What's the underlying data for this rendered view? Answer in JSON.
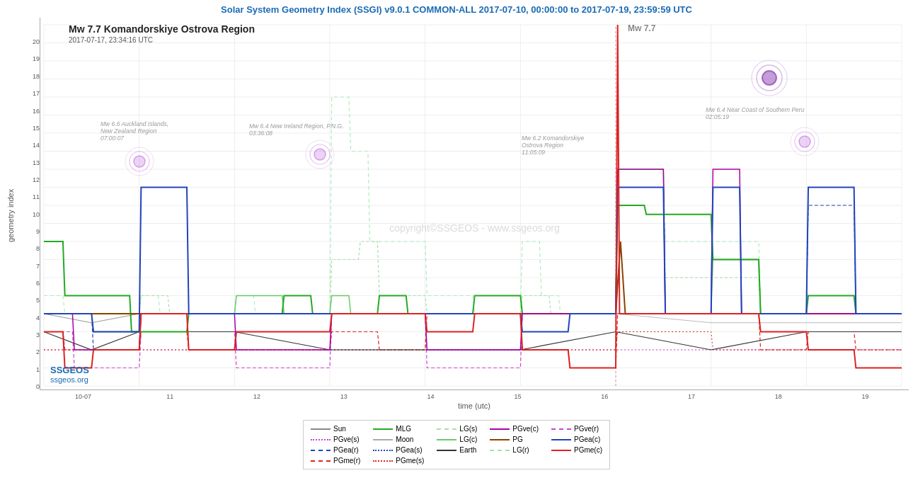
{
  "header": {
    "title": "Solar System Geometry Index (SSGI) v9.0.1 COMMON-ALL 2017-07-10, 00:00:00 to 2017-07-19, 23:59:59 UTC"
  },
  "chart": {
    "title": "Mw 7.7 Komandorskiye Ostrova Region",
    "subtitle": "2017-07-17, 23:34:16 UTC",
    "y_label": "geometry index",
    "x_label": "time (utc)",
    "y_ticks": [
      "0",
      "1",
      "2",
      "3",
      "4",
      "5",
      "6",
      "7",
      "8",
      "9",
      "10",
      "11",
      "12",
      "13",
      "14",
      "15",
      "16",
      "17",
      "18",
      "19",
      "20"
    ],
    "x_ticks": [
      "10-07",
      "11",
      "12",
      "13",
      "14",
      "15",
      "16",
      "17",
      "18",
      "19"
    ],
    "copyright": "copyright©SSGEOS - www.ssgeos.org"
  },
  "earthquakes": [
    {
      "label": "Mw 6.6 Auckland Islands,\nNew Zealand Region\n07:00:07",
      "x_pct": 10,
      "y_pct": 60
    },
    {
      "label": "Mw 6.4 New Ireland Region, P.N.G.\n03:36:08",
      "x_pct": 33,
      "y_pct": 52
    },
    {
      "label": "Mw 6.2 Komandorskiye\nOstrova Region\n11:05:09",
      "x_pct": 73,
      "y_pct": 38
    },
    {
      "label": "Mw 6.4 Near Coast of Southern Peru\n02:05:19",
      "x_pct": 89,
      "y_pct": 25
    }
  ],
  "legend": {
    "items": [
      {
        "label": "Sun",
        "style": "solid",
        "color": "#888888"
      },
      {
        "label": "MLG",
        "style": "solid",
        "color": "#22aa22"
      },
      {
        "label": "LG(s)",
        "style": "dashed-light",
        "color": "#aaddaa"
      },
      {
        "label": "PGve(c)",
        "style": "solid",
        "color": "#aa00aa"
      },
      {
        "label": "PGve(r)",
        "style": "dashed",
        "color": "#cc44cc"
      },
      {
        "label": "PGve(s)",
        "style": "dotted",
        "color": "#cc44cc"
      },
      {
        "label": "Moon",
        "style": "solid",
        "color": "#aaaaaa"
      },
      {
        "label": "LG(c)",
        "style": "solid",
        "color": "#66cc66"
      },
      {
        "label": "PG",
        "style": "solid",
        "color": "#884400"
      },
      {
        "label": "PGea(c)",
        "style": "solid",
        "color": "#2244bb"
      },
      {
        "label": "PGea(r)",
        "style": "dashed",
        "color": "#2244bb"
      },
      {
        "label": "PGea(s)",
        "style": "dotted",
        "color": "#2244bb"
      },
      {
        "label": "Earth",
        "style": "solid",
        "color": "#333333"
      },
      {
        "label": "LG(r)",
        "style": "dashed",
        "color": "#aaddaa"
      },
      {
        "label": "PGme(c)",
        "style": "solid",
        "color": "#dd2222"
      },
      {
        "label": "PGme(r)",
        "style": "dashed",
        "color": "#dd2222"
      },
      {
        "label": "PGme(s)",
        "style": "dotted",
        "color": "#dd2222"
      }
    ]
  },
  "ssgeos": {
    "name": "SSGEOS",
    "url": "ssgeos.org"
  }
}
